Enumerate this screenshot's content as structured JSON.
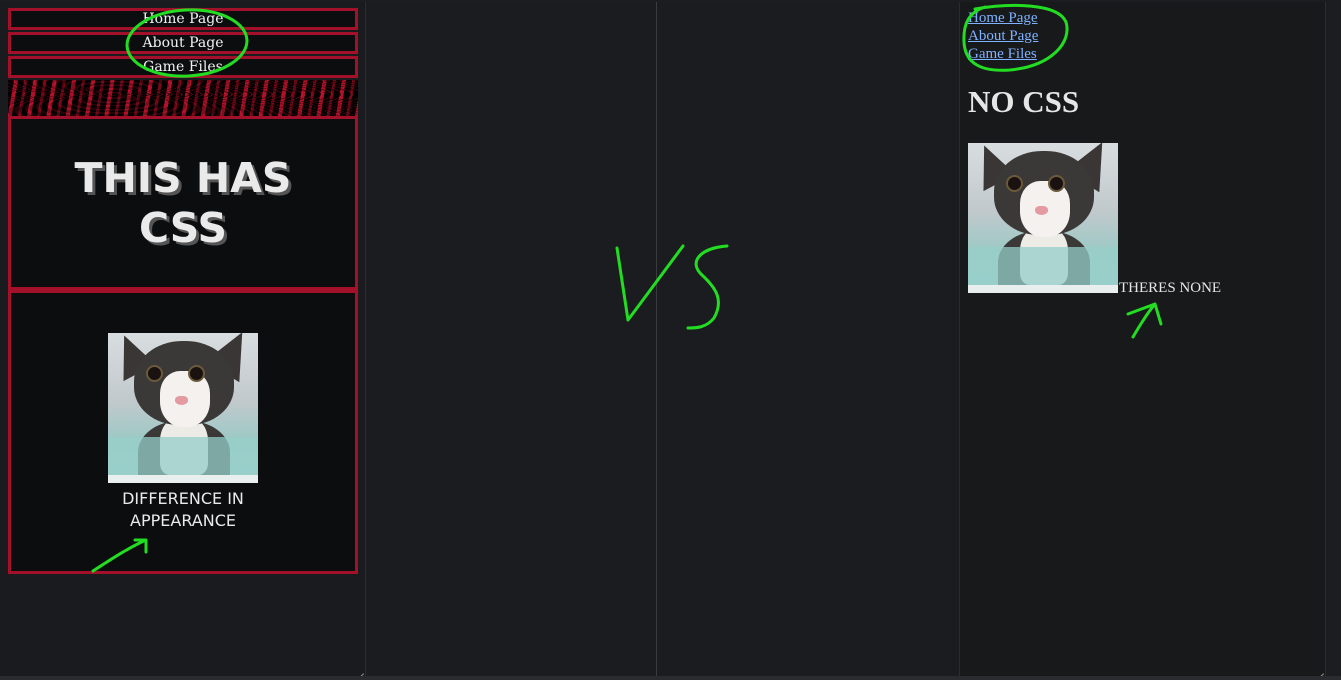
{
  "left_page": {
    "nav": [
      "Home Page",
      "About Page",
      "Game Files"
    ],
    "title_line1": "THIS HAS",
    "title_line2": "CSS",
    "image_icon": "cat-photo",
    "caption_line1": "DIFFERENCE IN",
    "caption_line2": "APPEARANCE"
  },
  "right_page": {
    "nav": [
      "Home Page",
      "About Page",
      "Game Files"
    ],
    "heading": "NO CSS",
    "image_icon": "cat-photo",
    "text": "THERES NONE"
  },
  "annotation": {
    "label": "VS",
    "color": "#22dd22"
  },
  "colors": {
    "accent_border": "#a3102a",
    "link": "#7fb2ff",
    "background": "#18191b"
  }
}
